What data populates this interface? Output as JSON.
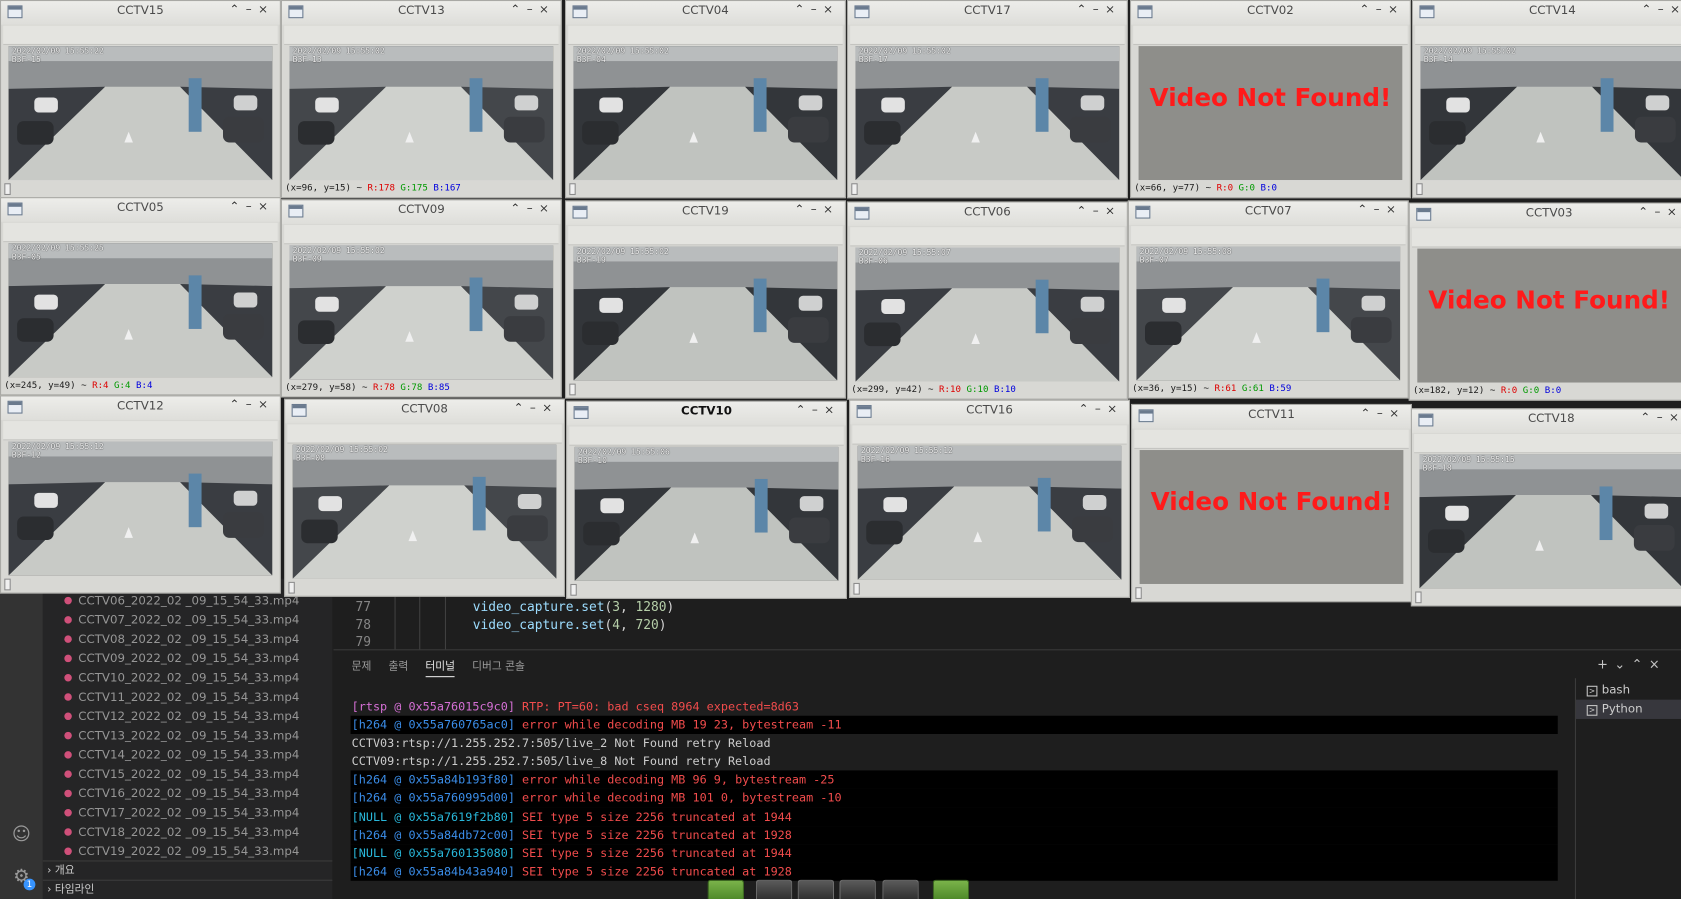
{
  "cameras": [
    {
      "title": "CCTV15",
      "osd": "2022/02/09 15:55:22",
      "osd2": "B3F-15",
      "status": "",
      "r": "",
      "g": "",
      "b": "",
      "found": true
    },
    {
      "title": "CCTV13",
      "osd": "2022/02/09 15:55:02",
      "osd2": "B3F-13",
      "status": "(x=96, y=15) ~",
      "r": "R:178",
      "g": "G:175",
      "b": "B:167",
      "found": true
    },
    {
      "title": "CCTV04",
      "osd": "2022/02/09 15:55:02",
      "osd2": "B3F-04",
      "status": "",
      "r": "",
      "g": "",
      "b": "",
      "found": true
    },
    {
      "title": "CCTV17",
      "osd": "2022/02/09 15:55:02",
      "osd2": "B3F-17",
      "status": "",
      "r": "",
      "g": "",
      "b": "",
      "found": true
    },
    {
      "title": "CCTV02",
      "osd": "",
      "osd2": "",
      "status": "(x=66, y=77) ~",
      "r": "R:0",
      "g": "G:0",
      "b": "B:0",
      "found": false,
      "nf": "Video Not Found!"
    },
    {
      "title": "CCTV14",
      "osd": "2022/02/09 15:55:02",
      "osd2": "B3F-14",
      "status": "",
      "r": "",
      "g": "",
      "b": "",
      "found": true
    },
    {
      "title": "CCTV05",
      "osd": "2022/02/09 15:55:25",
      "osd2": "B3F-05",
      "status": "(x=245, y=49) ~",
      "r": "R:4",
      "g": "G:4",
      "b": "B:4",
      "found": true
    },
    {
      "title": "CCTV09",
      "osd": "2022/02/09 15:55:02",
      "osd2": "B3F-09",
      "status": "(x=279, y=58) ~",
      "r": "R:78",
      "g": "G:78",
      "b": "B:85",
      "found": true
    },
    {
      "title": "CCTV19",
      "osd": "2022/02/09 15:55:02",
      "osd2": "B3F-19",
      "status": "",
      "r": "",
      "g": "",
      "b": "",
      "found": true
    },
    {
      "title": "CCTV06",
      "osd": "2022/02/09 15:55:07",
      "osd2": "B3F-06",
      "status": "(x=299, y=42) ~",
      "r": "R:10",
      "g": "G:10",
      "b": "B:10",
      "found": true
    },
    {
      "title": "CCTV07",
      "osd": "2022/02/09 15:55:08",
      "osd2": "B3F-07",
      "status": "(x=36, y=15) ~",
      "r": "R:61",
      "g": "G:61",
      "b": "B:59",
      "found": true
    },
    {
      "title": "CCTV03",
      "osd": "",
      "osd2": "",
      "status": "(x=182, y=12) ~",
      "r": "R:0",
      "g": "G:0",
      "b": "B:0",
      "found": false,
      "nf": "Video Not Found!"
    },
    {
      "title": "CCTV12",
      "osd": "2022/02/09 15:55:12",
      "osd2": "B3F-12",
      "status": "",
      "r": "",
      "g": "",
      "b": "",
      "found": true
    },
    {
      "title": "CCTV08",
      "osd": "2022/02/09 15:55:02",
      "osd2": "B3F-08",
      "status": "",
      "r": "",
      "g": "",
      "b": "",
      "found": true
    },
    {
      "title": "CCTV10",
      "osd": "2022/02/09 15:55:06",
      "osd2": "B3F-10",
      "status": "",
      "r": "",
      "g": "",
      "b": "",
      "found": true
    },
    {
      "title": "CCTV16",
      "osd": "2022/02/09 15:55:12",
      "osd2": "B3F-16",
      "status": "",
      "r": "",
      "g": "",
      "b": "",
      "found": true
    },
    {
      "title": "CCTV11",
      "osd": "",
      "osd2": "",
      "status": "",
      "r": "",
      "g": "",
      "b": "",
      "found": false,
      "nf": "Video Not Found!"
    },
    {
      "title": "CCTV18",
      "osd": "2022/02/09 15:55:15",
      "osd2": "B3F-18",
      "status": "",
      "r": "",
      "g": "",
      "b": "",
      "found": true
    }
  ],
  "files": [
    "CCTV06_2022_02 _09_15_54_33.mp4",
    "CCTV07_2022_02 _09_15_54_33.mp4",
    "CCTV08_2022_02 _09_15_54_33.mp4",
    "CCTV09_2022_02 _09_15_54_33.mp4",
    "CCTV10_2022_02 _09_15_54_33.mp4",
    "CCTV11_2022_02 _09_15_54_33.mp4",
    "CCTV12_2022_02 _09_15_54_33.mp4",
    "CCTV13_2022_02 _09_15_54_33.mp4",
    "CCTV14_2022_02 _09_15_54_33.mp4",
    "CCTV15_2022_02 _09_15_54_33.mp4",
    "CCTV16_2022_02 _09_15_54_33.mp4",
    "CCTV17_2022_02 _09_15_54_33.mp4",
    "CCTV18_2022_02 _09_15_54_33.mp4",
    "CCTV19_2022_02 _09_15_54_33.mp4"
  ],
  "sidebar": {
    "outline": "개요",
    "timeline": "타임라인",
    "accounts_badge": "1"
  },
  "editor": {
    "lines": [
      {
        "num": "77",
        "call": "video_capture.set",
        "arg1": "3",
        "arg2": "1280"
      },
      {
        "num": "78",
        "call": "video_capture.set",
        "arg1": "4",
        "arg2": "720"
      },
      {
        "num": "79",
        "call": "",
        "arg1": "",
        "arg2": ""
      }
    ]
  },
  "panel": {
    "tabs": [
      "문제",
      "출력",
      "터미널",
      "디버그 콘솔"
    ],
    "active_tab": "터미널",
    "terminal_lines": [
      {
        "tag": "[rtsp @ 0x55a76015c9c0]",
        "msg": "RTP: PT=60: bad cseq 8964 expected=8d63",
        "tk": "m",
        "mk": ""
      },
      {
        "tag": "[h264 @ 0x55a760765ac0]",
        "msg": "error while decoding MB 19 23, bytestream -11",
        "tk": "",
        "mk": ""
      },
      {
        "tag": "",
        "msg": "CCTV03:rtsp://1.255.252.7:505/live_2 Not Found retry Reload",
        "tk": "",
        "mk": "w"
      },
      {
        "tag": "",
        "msg": "CCTV09:rtsp://1.255.252.7:505/live_8 Not Found retry Reload",
        "tk": "",
        "mk": "w"
      },
      {
        "tag": "[h264 @ 0x55a84b193f80]",
        "msg": "error while decoding MB 96 9, bytestream -25",
        "tk": "",
        "mk": ""
      },
      {
        "tag": "[h264 @ 0x55a760995d00]",
        "msg": "error while decoding MB 101 0, bytestream -10",
        "tk": "",
        "mk": ""
      },
      {
        "tag": "[NULL @ 0x55a7619f2b80]",
        "msg": "SEI type 5 size 2256 truncated at 1944",
        "tk": "c",
        "mk": ""
      },
      {
        "tag": "[h264 @ 0x55a84db72c00]",
        "msg": "SEI type 5 size 2256 truncated at 1928",
        "tk": "",
        "mk": ""
      },
      {
        "tag": "[NULL @ 0x55a760135080]",
        "msg": "SEI type 5 size 2256 truncated at 1944",
        "tk": "c",
        "mk": ""
      },
      {
        "tag": "[h264 @ 0x55a84b43a940]",
        "msg": "SEI type 5 size 2256 truncated at 1928",
        "tk": "",
        "mk": ""
      }
    ],
    "terminals": [
      "bash",
      "Python"
    ],
    "active_terminal": "Python"
  }
}
